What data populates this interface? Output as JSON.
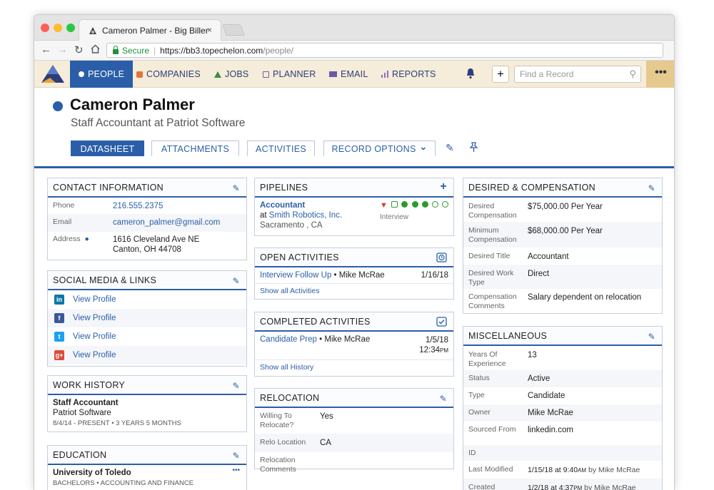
{
  "browser": {
    "tab_title": "Cameron Palmer - Big Biller",
    "tab_close": "×",
    "secure_label": "Secure",
    "url_main": "https://bb3.topechelon.com",
    "url_path": "/people/"
  },
  "nav": {
    "people": "PEOPLE",
    "companies": "COMPANIES",
    "jobs": "JOBS",
    "planner": "PLANNER",
    "email": "EMAIL",
    "reports": "REPORTS",
    "plus": "+",
    "find_placeholder": "Find a Record",
    "more": "•••"
  },
  "header": {
    "name": "Cameron Palmer",
    "subtitle": "Staff Accountant at Patriot Software",
    "tabs": {
      "datasheet": "DATASHEET",
      "attachments": "ATTACHMENTS",
      "activities": "ACTIVITIES",
      "record_options": "RECORD OPTIONS"
    },
    "chevron": "⌄"
  },
  "contact": {
    "title": "CONTACT INFORMATION",
    "phone_label": "Phone",
    "phone": "216.555.2375",
    "email_label": "Email",
    "email": "cameron_palmer@gmail.com",
    "address_label": "Address",
    "address1": "1616 Cleveland Ave NE",
    "address2": "Canton, OH 44708"
  },
  "social": {
    "title": "SOCIAL MEDIA & LINKS",
    "items": [
      "View Profile",
      "View Profile",
      "View Profile",
      "View Profile"
    ]
  },
  "work": {
    "title": "WORK HISTORY",
    "position": "Staff Accountant",
    "company": "Patriot Software",
    "dates": "8/4/14 - PRESENT  •  3 YEARS 5 MONTHS"
  },
  "education": {
    "title": "EDUCATION",
    "school": "University of Toledo",
    "degree": "BACHELORS  •  ACCOUNTING AND FINANCE",
    "more": "•••"
  },
  "pipelines": {
    "title": "PIPELINES",
    "job": "Accountant",
    "company_prefix": "at",
    "company": "Smith Robotics, Inc.",
    "location": "Sacramento , CA",
    "stage": "Interview"
  },
  "open_activities": {
    "title": "OPEN ACTIVITIES",
    "item": "Interview Follow Up",
    "sep": "•",
    "owner": "Mike McRae",
    "date": "1/16/18",
    "show_all": "Show all Activities"
  },
  "completed": {
    "title": "COMPLETED ACTIVITIES",
    "item": "Candidate Prep",
    "sep": "•",
    "owner": "Mike McRae",
    "date": "1/5/18",
    "time": "12:34",
    "ampm": "PM",
    "show_all": "Show all History"
  },
  "relocation": {
    "title": "RELOCATION",
    "willing_label": "Willing To Relocate?",
    "willing": "Yes",
    "location_label": "Relo Location",
    "location": "CA",
    "comments_label": "Relocation Comments"
  },
  "desired": {
    "title": "DESIRED & COMPENSATION",
    "rows": [
      {
        "k": "Desired Compensation",
        "v": "$75,000.00 Per Year"
      },
      {
        "k": "Minimum Compensation",
        "v": "$68,000.00 Per Year"
      },
      {
        "k": "Desired Title",
        "v": "Accountant"
      },
      {
        "k": "Desired Work Type",
        "v": "Direct"
      },
      {
        "k": "Compensation Comments",
        "v": "Salary dependent on relocation"
      }
    ]
  },
  "misc": {
    "title": "MISCELLANEOUS",
    "rows": [
      {
        "k": "Years Of Experience",
        "v": "13"
      },
      {
        "k": "Status",
        "v": "Active"
      },
      {
        "k": "Type",
        "v": "Candidate"
      },
      {
        "k": "Owner",
        "v": "Mike McRae"
      },
      {
        "k": "Sourced From",
        "v": "linkedin.com"
      },
      {
        "k": "ID",
        "v": ""
      }
    ],
    "modified_label": "Last Modified",
    "modified_date": "1/15/18 at 9:40",
    "modified_ampm": "AM",
    "modified_by": "by Mike McRae",
    "created_label": "Created",
    "created_date": "1/2/18 at 4:37",
    "created_ampm": "PM",
    "created_by": "by Mike McRae"
  },
  "colors": {
    "primary": "#2b5ea8",
    "nav_bg": "#f5ecd9",
    "active_green": "#2c9a2c",
    "alert_red": "#d23c3c"
  }
}
